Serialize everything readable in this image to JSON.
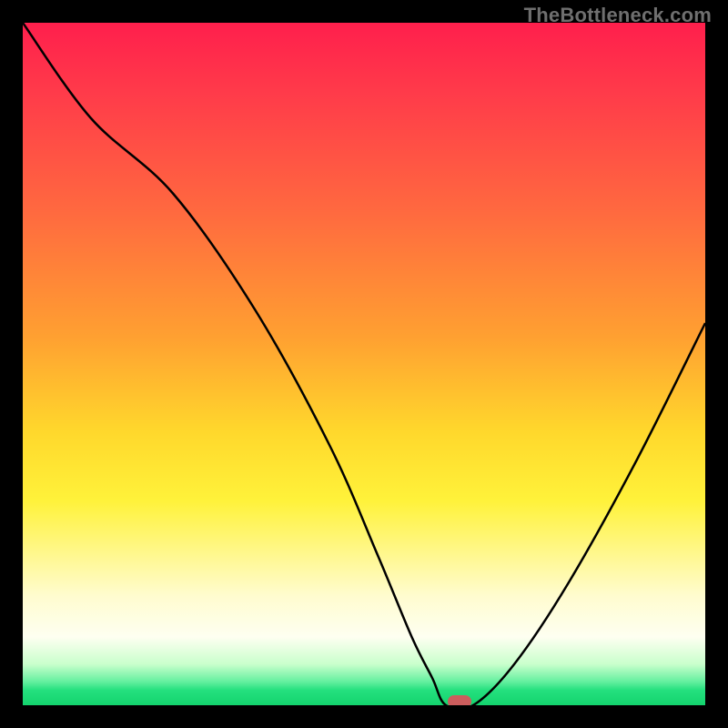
{
  "watermark": "TheBottleneck.com",
  "colors": {
    "frame": "#000000",
    "curve": "#000000",
    "marker": "#cc5d5d",
    "watermark_text": "#6f6f6f"
  },
  "chart_data": {
    "type": "line",
    "title": "",
    "xlabel": "",
    "ylabel": "",
    "xlim": [
      0,
      100
    ],
    "ylim": [
      0,
      100
    ],
    "grid": false,
    "series": [
      {
        "name": "bottleneck-curve",
        "x": [
          0,
          10,
          22,
          34,
          45,
          52,
          57,
          60,
          62,
          66,
          72,
          80,
          90,
          100
        ],
        "y": [
          100,
          86,
          75,
          58,
          38,
          22,
          10,
          4,
          0,
          0,
          6,
          18,
          36,
          56
        ]
      }
    ],
    "marker": {
      "x": 64,
      "y": 0
    },
    "gradient_stops": [
      {
        "pos": 0.0,
        "color": "#ff1f4c"
      },
      {
        "pos": 0.28,
        "color": "#ff6a3f"
      },
      {
        "pos": 0.6,
        "color": "#ffd82c"
      },
      {
        "pos": 0.84,
        "color": "#fffccf"
      },
      {
        "pos": 0.94,
        "color": "#c9ffcc"
      },
      {
        "pos": 1.0,
        "color": "#14d46e"
      }
    ]
  }
}
